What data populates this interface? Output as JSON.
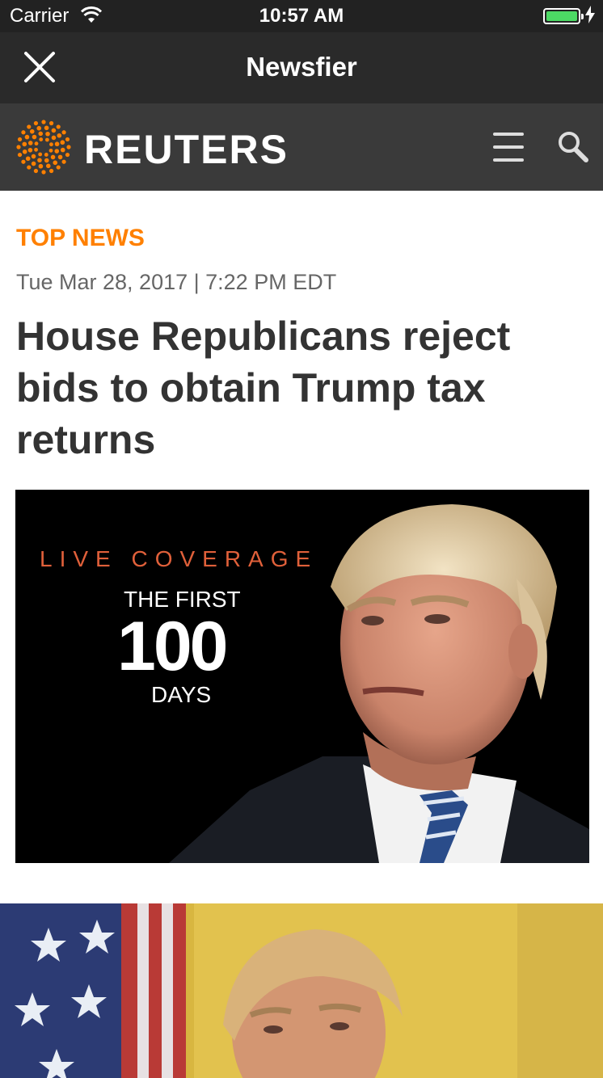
{
  "status_bar": {
    "carrier": "Carrier",
    "time": "10:57 AM",
    "battery_percent": 100,
    "charging": true
  },
  "app_bar": {
    "title": "Newsfier",
    "close_icon": "close-icon"
  },
  "site_header": {
    "brand": "REUTERS",
    "logo_icon": "reuters-logo-icon",
    "menu_icon": "hamburger-menu-icon",
    "search_icon": "search-icon"
  },
  "article": {
    "section": "TOP NEWS",
    "dateline": "Tue Mar 28, 2017 | 7:22 PM EDT",
    "headline": "House Republicans reject bids to obtain Trump tax returns",
    "hero_image": {
      "overlay_kicker": "LIVE COVERAGE",
      "overlay_line1": "THE FIRST",
      "overlay_number": "100",
      "overlay_line2": "DAYS"
    }
  },
  "colors": {
    "section_accent": "#ff8000",
    "app_bar": "#2a2a2a",
    "site_bar": "#3a3a3a",
    "logo_orange": "#ff8000",
    "battery_green": "#4cd964"
  }
}
